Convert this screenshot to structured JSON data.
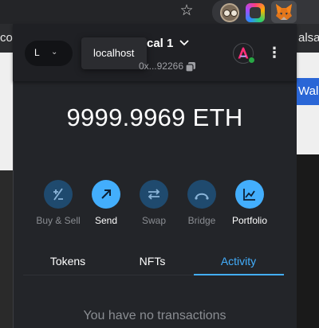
{
  "browser": {
    "bookmarks_left": "co",
    "bookmarks_right": "alsa",
    "extensions": [
      "owl-extension-icon",
      "color-ring-extension-icon",
      "fox-extension-icon"
    ]
  },
  "page_background": {
    "blue_button_text": "Walle"
  },
  "wallet": {
    "header": {
      "network_letter": "L",
      "network_tooltip": "localhost",
      "account_name": "cal 1",
      "address": "0x...92266",
      "avatar_letter": "A",
      "status_color": "#28a745",
      "menu_icon": "kebab-menu-icon"
    },
    "balance": "9999.9969 ETH",
    "actions": [
      {
        "label": "Buy & Sell",
        "icon": "buy-sell-icon",
        "enabled": false
      },
      {
        "label": "Send",
        "icon": "send-arrow-icon",
        "enabled": true
      },
      {
        "label": "Swap",
        "icon": "swap-icon",
        "enabled": false
      },
      {
        "label": "Bridge",
        "icon": "bridge-icon",
        "enabled": false
      },
      {
        "label": "Portfolio",
        "icon": "portfolio-chart-icon",
        "enabled": true
      }
    ],
    "tabs": [
      {
        "label": "Tokens",
        "active": false
      },
      {
        "label": "NFTs",
        "active": false
      },
      {
        "label": "Activity",
        "active": true
      }
    ],
    "empty_message": "You have no transactions",
    "colors": {
      "accent": "#43aefc",
      "accent_dim": "#1f4a6e",
      "popup_bg": "#232529",
      "header_bg": "#1f2024"
    }
  }
}
